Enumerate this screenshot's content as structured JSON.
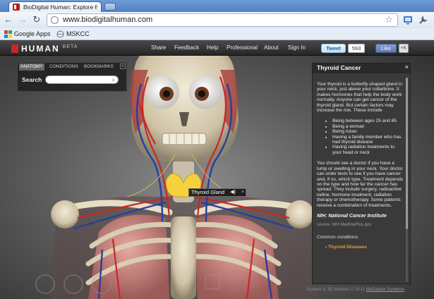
{
  "browser": {
    "tab_title": "BioDigital Human: Explore t",
    "url": "www.biodigitalhuman.com",
    "bookmarks": [
      "Google Apps",
      "MSKCC"
    ]
  },
  "site": {
    "logo": "HUMAN",
    "beta": "BETA",
    "nav": [
      "Share",
      "Feedback",
      "Help",
      "Professional",
      "About",
      "Sign In"
    ],
    "tweet_label": "Tweet",
    "tweet_count": "593",
    "like_label": "Like",
    "share_small": "+K"
  },
  "left_panel": {
    "tabs": [
      "ANATOMY",
      "CONDITIONS",
      "BOOKMARKS"
    ],
    "search_label": "Search",
    "search_value": ""
  },
  "tooltip": {
    "label": "Thyroid Gland"
  },
  "info_panel": {
    "title": "Thyroid Cancer",
    "intro": "Your thyroid is a butterfly-shaped gland in your neck, just above your collarbone. It makes hormones that help the body work normally. Anyone can get cancer of the thyroid gland. But certain factors may increase the risk. These include",
    "risks": [
      "Being between ages 25 and 65",
      "Being a woman",
      "Being Asian",
      "Having a family member who has had thyroid disease",
      "Having radiation treatments to your head or neck"
    ],
    "treatment": "You should see a doctor if you have a lump or swelling in your neck. Your doctor can order tests to see if you have cancer and, if so, which type. Treatment depends on the type and how far the cancer has spread. They include surgery, radioactive iodine, hormone treatment, radiation therapy or chemotherapy. Some patients receive a combination of treatments.",
    "source_title": "NIH: National Cancer Institute",
    "source": "source: NIH MedlinePlus.gov",
    "common_label": "Common conditions",
    "common_link": "Thyroid Diseases"
  },
  "footer": {
    "text": "System & 3D Models © 2011",
    "link": "BioDigital Systems"
  }
}
